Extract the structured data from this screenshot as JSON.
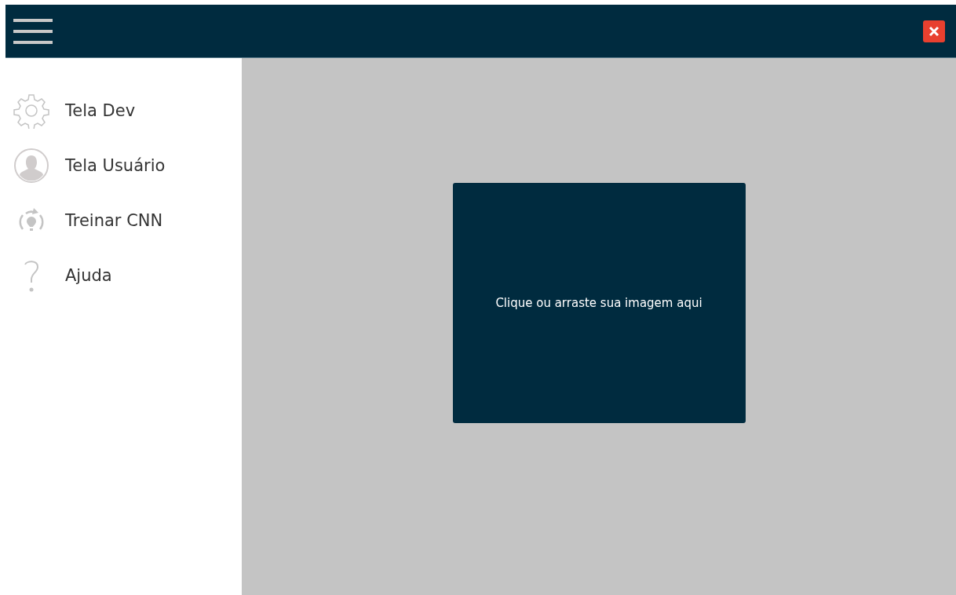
{
  "sidebar": {
    "items": [
      {
        "label": "Tela Dev",
        "kind": "gear"
      },
      {
        "label": "Tela Usuário",
        "kind": "user"
      },
      {
        "label": "Treinar CNN",
        "kind": "train"
      },
      {
        "label": "Ajuda",
        "kind": "help"
      }
    ]
  },
  "dropzone": {
    "text": "Clique ou arraste sua imagem aqui"
  }
}
